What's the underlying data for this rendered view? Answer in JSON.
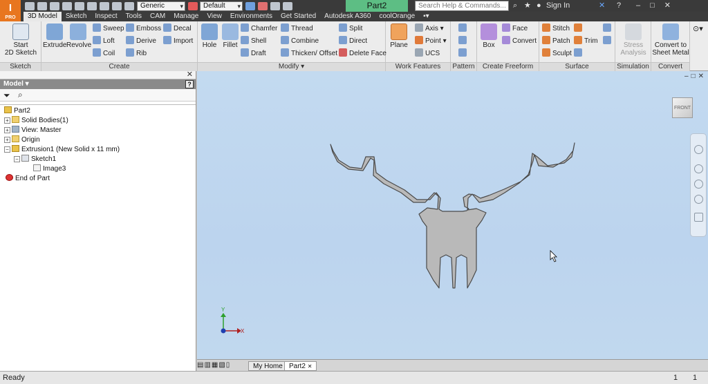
{
  "app": {
    "badge": "I",
    "badge_sub": "PRO"
  },
  "qat": {
    "appearance": "Generic",
    "material": "Default",
    "doc_title": "Part2",
    "search_placeholder": "Search Help & Commands...",
    "sign_in": "Sign In"
  },
  "tabs": [
    "3D Model",
    "Sketch",
    "Inspect",
    "Tools",
    "CAM",
    "Manage",
    "View",
    "Environments",
    "Get Started",
    "Autodesk A360",
    "coolOrange"
  ],
  "ribbon": {
    "sketch": {
      "label": "Sketch",
      "start": "Start",
      "start2": "2D Sketch"
    },
    "create": {
      "label": "Create",
      "extrude": "Extrude",
      "revolve": "Revolve",
      "sweep": "Sweep",
      "loft": "Loft",
      "coil": "Coil",
      "emboss": "Emboss",
      "derive": "Derive",
      "rib": "Rib",
      "decal": "Decal",
      "import": "Import"
    },
    "modify": {
      "label": "Modify",
      "hole": "Hole",
      "fillet": "Fillet",
      "chamfer": "Chamfer",
      "shell": "Shell",
      "draft": "Draft",
      "thread": "Thread",
      "combine": "Combine",
      "thicken": "Thicken/ Offset",
      "split": "Split",
      "direct": "Direct",
      "delete_face": "Delete Face"
    },
    "work": {
      "label": "Work Features",
      "plane": "Plane",
      "axis": "Axis",
      "point": "Point",
      "ucs": "UCS"
    },
    "pattern": {
      "label": "Pattern"
    },
    "freeform": {
      "label": "Create Freeform",
      "box": "Box",
      "face": "Face",
      "convert": "Convert"
    },
    "surface": {
      "label": "Surface",
      "stitch": "Stitch",
      "patch": "Patch",
      "sculpt": "Sculpt",
      "trim": "Trim"
    },
    "simulation": {
      "label": "Simulation",
      "stress": "Stress",
      "stress2": "Analysis"
    },
    "convert": {
      "label": "Convert",
      "c1": "Convert to",
      "c2": "Sheet Metal"
    }
  },
  "browser": {
    "header": "Model",
    "tree": [
      {
        "label": "Part2"
      },
      {
        "label": "Solid Bodies(1)"
      },
      {
        "label": "View: Master"
      },
      {
        "label": "Origin"
      },
      {
        "label": "Extrusion1 (New Solid x 11 mm)"
      },
      {
        "label": "Sketch1"
      },
      {
        "label": "Image3"
      },
      {
        "label": "End of Part"
      }
    ]
  },
  "viewport": {
    "viewcube": "FRONT",
    "axis_y": "Y",
    "axis_x": "X"
  },
  "doc_tabs": {
    "home": "My Home",
    "part": "Part2"
  },
  "status": {
    "text": "Ready",
    "n1": "1",
    "n2": "1"
  },
  "colors": {
    "accent": "#e8761f",
    "title_green": "#5dbe84",
    "viewport_bg": "#c1d8ee",
    "part_fill": "#b9b9b9"
  }
}
